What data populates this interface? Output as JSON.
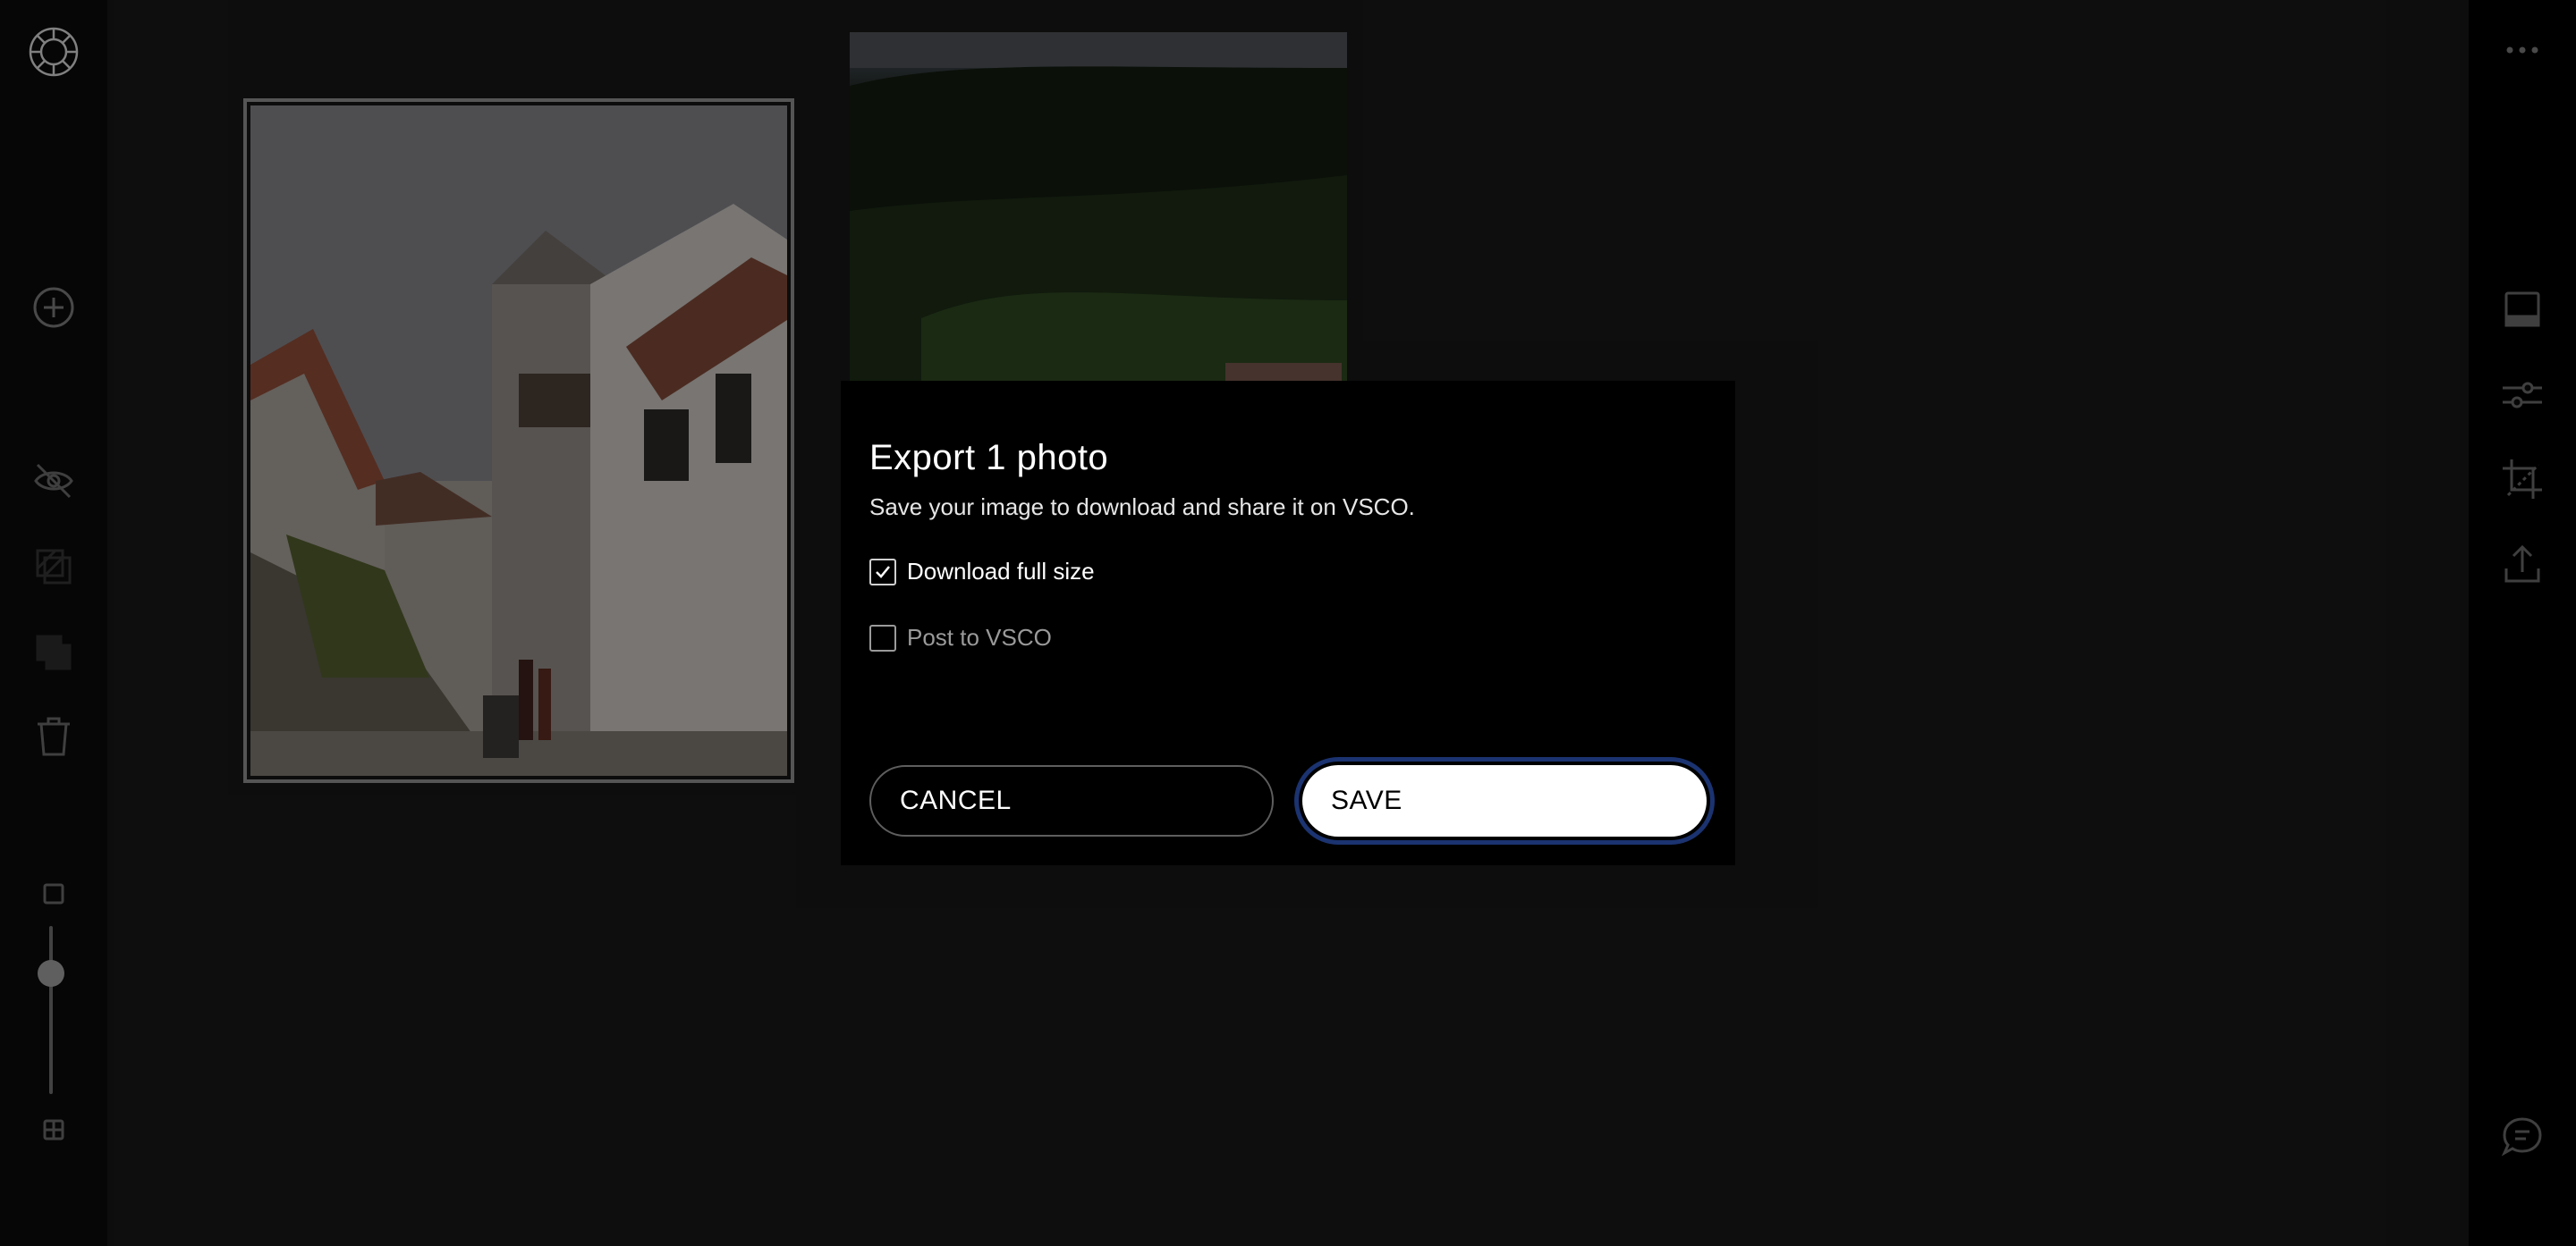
{
  "app": {
    "left_rail": {
      "logo_icon": "vsco-logo-icon",
      "icons": [
        "add-icon",
        "hide-icon",
        "duplicate-icon",
        "copy-icon",
        "trash-icon"
      ],
      "zoom": {
        "min_icon": "single-square-icon",
        "max_icon": "grid-icon",
        "level": 0.28
      }
    },
    "right_rail": {
      "icons": [
        "more-icon",
        "preset-icon",
        "adjust-icon",
        "crop-icon",
        "export-icon",
        "feedback-icon"
      ]
    },
    "photos": [
      {
        "subject": "street with white houses",
        "selected": true
      },
      {
        "subject": "hillside with colorful houses",
        "selected": false
      }
    ]
  },
  "dialog": {
    "title": "Export 1 photo",
    "description": "Save your image to download and share it on VSCO.",
    "options": [
      {
        "label": "Download full size",
        "checked": true
      },
      {
        "label": "Post to VSCO",
        "checked": false
      }
    ],
    "cancel_label": "CANCEL",
    "save_label": "SAVE"
  },
  "colors": {
    "focus_ring": "#1b3370",
    "canvas": "#161616",
    "dialog_bg": "#000000"
  }
}
